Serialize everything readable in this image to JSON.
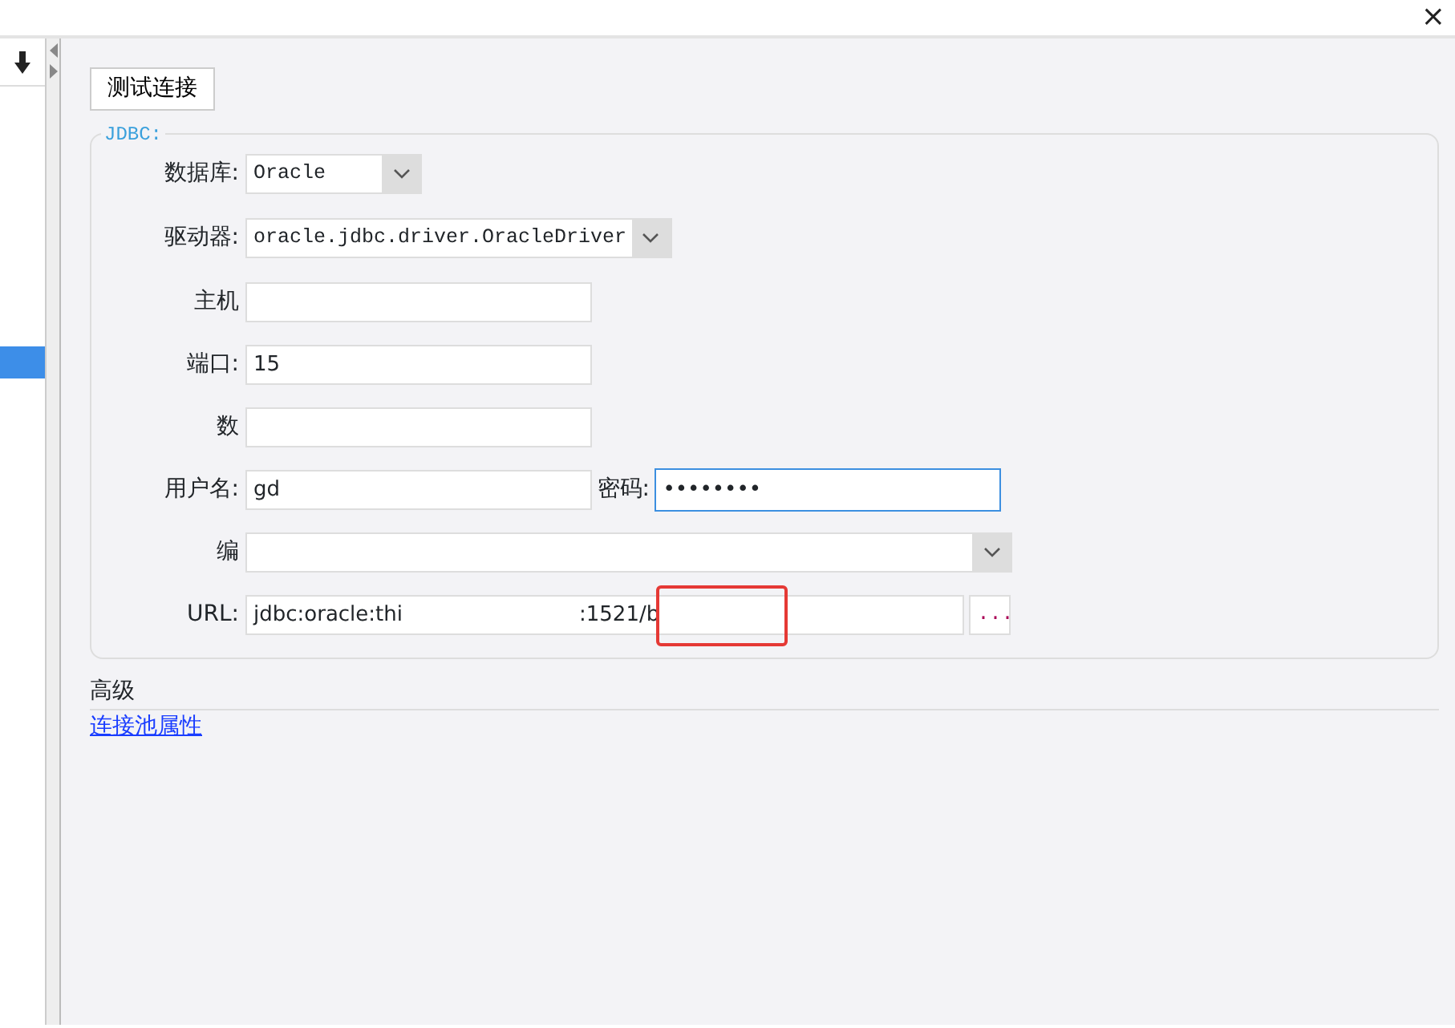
{
  "window": {
    "close": "×"
  },
  "sidebar": {
    "items": [
      {
        "selected": true
      }
    ]
  },
  "test_button": "测试连接",
  "jdbc": {
    "legend": "JDBC:",
    "rows": [
      {
        "kind": "select",
        "label": "数据库:",
        "value": "Oracle"
      },
      {
        "kind": "select",
        "label": "驱动器:",
        "value": "oracle.jdbc.driver.OracleDriver"
      },
      {
        "kind": "text",
        "label": "主机",
        "value": ""
      },
      {
        "kind": "text",
        "label": "端口:",
        "value": "15"
      },
      {
        "kind": "text",
        "label": "数",
        "value": ""
      },
      {
        "kind": "login",
        "label": "用户名:",
        "value": "gd",
        "password_label": "密码:",
        "password": "••••••••",
        "focused": true
      },
      {
        "kind": "select",
        "label": "编",
        "value": ""
      },
      {
        "kind": "url",
        "label": "URL:",
        "value_start": "jdbc:oracle:thi",
        "value_end": ":1521/b",
        "button": "...",
        "highlighted": true
      }
    ]
  },
  "advanced": {
    "title": "高级",
    "link": "连接池属性"
  }
}
